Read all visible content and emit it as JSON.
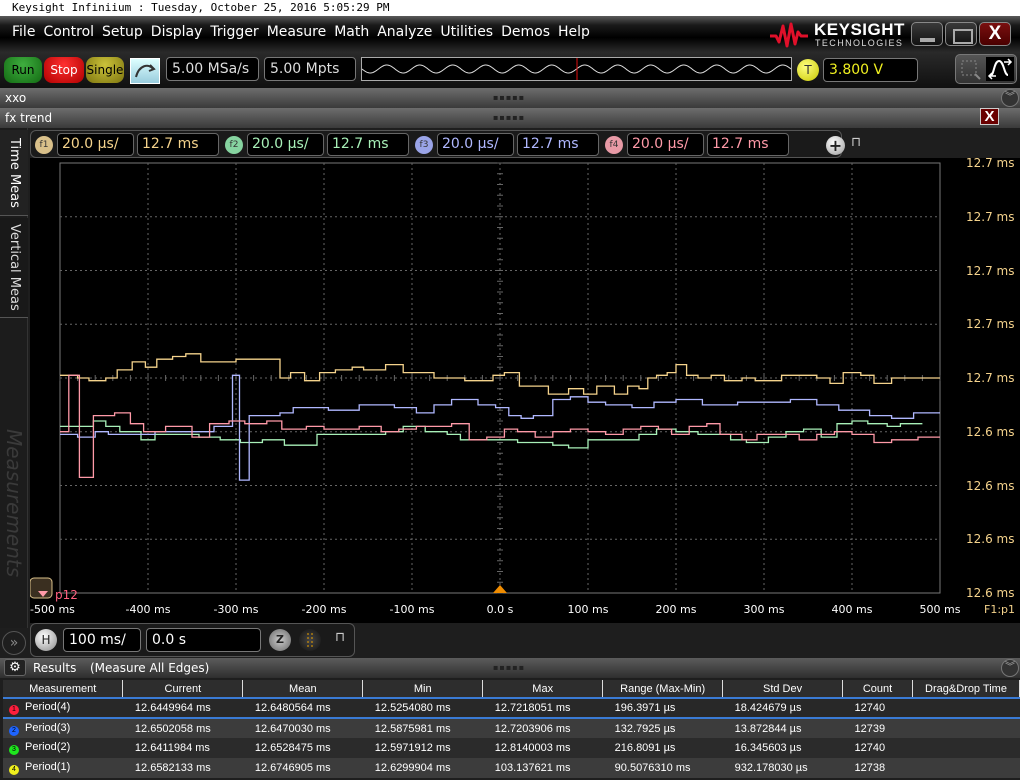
{
  "window": {
    "title": "Keysight Infiniium : Tuesday, October 25, 2016 5:05:29 PM",
    "brand": "KEYSIGHT",
    "brand_sub": "TECHNOLOGIES",
    "close_label": "X"
  },
  "menu": [
    "File",
    "Control",
    "Setup",
    "Display",
    "Trigger",
    "Measure",
    "Math",
    "Analyze",
    "Utilities",
    "Demos",
    "Help"
  ],
  "toolbar": {
    "run": "Run",
    "stop": "Stop",
    "single": "Single",
    "sample_rate": "5.00 MSa/s",
    "memory_depth": "5.00 Mpts",
    "trigger_badge": "T",
    "trigger_level": "3.800 V"
  },
  "panels": {
    "xxo": "xxo",
    "fx_trend": "fx trend",
    "grip": "▪▪▪▪▪"
  },
  "side_tabs": [
    "Time Meas",
    "Vertical Meas"
  ],
  "side_ghost": "Measurements",
  "functions": [
    {
      "badge": "f1",
      "scale": "20.0 µs/",
      "offset": "12.7 ms",
      "color": "#f5d38c",
      "badge_color": "#d9c08a"
    },
    {
      "badge": "f2",
      "scale": "20.0 µs/",
      "offset": "12.7 ms",
      "color": "#a8f0b8",
      "badge_color": "#86d4a0"
    },
    {
      "badge": "f3",
      "scale": "20.0 µs/",
      "offset": "12.7 ms",
      "color": "#b0b8ff",
      "badge_color": "#9aa4e8"
    },
    {
      "badge": "f4",
      "scale": "20.0 µs/",
      "offset": "12.7 ms",
      "color": "#ff9aa8",
      "badge_color": "#e89aa6"
    }
  ],
  "horizontal": {
    "badge": "H",
    "scale": "100 ms/",
    "position": "0.0 s"
  },
  "plot_marker": "p12",
  "plot_source": "F1:p1",
  "chart_data": {
    "type": "line",
    "title": "fx trend",
    "xlabel": "",
    "ylabel": "",
    "x_ticks": [
      "-500 ms",
      "-400 ms",
      "-300 ms",
      "-200 ms",
      "-100 ms",
      "0.0 s",
      "100 ms",
      "200 ms",
      "300 ms",
      "400 ms",
      "500 ms"
    ],
    "y_ticks": [
      "12.7 ms",
      "12.7 ms",
      "12.7 ms",
      "12.7 ms",
      "12.7 ms",
      "12.6 ms",
      "12.6 ms",
      "12.6 ms",
      "12.6 ms"
    ],
    "xlim_ms": [
      -500,
      500
    ],
    "ylim_ms": [
      12.62,
      12.78
    ],
    "grid": true,
    "step": true,
    "series": [
      {
        "name": "f1",
        "color": "#f5d38c",
        "points": [
          [
            -500,
            12.701
          ],
          [
            -480,
            12.7
          ],
          [
            -467,
            12.699
          ],
          [
            -448,
            12.7
          ],
          [
            -435,
            12.703
          ],
          [
            -418,
            12.706
          ],
          [
            -403,
            12.704
          ],
          [
            -390,
            12.707
          ],
          [
            -372,
            12.708
          ],
          [
            -357,
            12.709
          ],
          [
            -340,
            12.706
          ],
          [
            -300,
            12.707
          ],
          [
            -275,
            12.707
          ],
          [
            -250,
            12.7
          ],
          [
            -238,
            12.702
          ],
          [
            -222,
            12.699
          ],
          [
            -205,
            12.702
          ],
          [
            -187,
            12.703
          ],
          [
            -168,
            12.704
          ],
          [
            -155,
            12.703
          ],
          [
            -130,
            12.705
          ],
          [
            -110,
            12.702
          ],
          [
            -93,
            12.702
          ],
          [
            -75,
            12.7
          ],
          [
            -58,
            12.7
          ],
          [
            -40,
            12.699
          ],
          [
            -22,
            12.699
          ],
          [
            -8,
            12.701
          ],
          [
            5,
            12.702
          ],
          [
            22,
            12.697
          ],
          [
            40,
            12.697
          ],
          [
            55,
            12.694
          ],
          [
            78,
            12.696
          ],
          [
            95,
            12.694
          ],
          [
            110,
            12.697
          ],
          [
            130,
            12.694
          ],
          [
            145,
            12.697
          ],
          [
            158,
            12.696
          ],
          [
            168,
            12.7
          ],
          [
            178,
            12.701
          ],
          [
            190,
            12.702
          ],
          [
            200,
            12.705
          ],
          [
            212,
            12.701
          ],
          [
            225,
            12.7
          ],
          [
            240,
            12.701
          ],
          [
            255,
            12.699
          ],
          [
            275,
            12.7
          ],
          [
            290,
            12.699
          ],
          [
            305,
            12.699
          ],
          [
            320,
            12.701
          ],
          [
            340,
            12.701
          ],
          [
            360,
            12.7
          ],
          [
            375,
            12.698
          ],
          [
            390,
            12.702
          ],
          [
            410,
            12.701
          ],
          [
            425,
            12.698
          ],
          [
            445,
            12.7
          ],
          [
            470,
            12.7
          ],
          [
            490,
            12.7
          ]
        ]
      },
      {
        "name": "f2",
        "color": "#a8f0b8",
        "points": [
          [
            -500,
            12.682
          ],
          [
            -462,
            12.684
          ],
          [
            -448,
            12.682
          ],
          [
            -432,
            12.68
          ],
          [
            -408,
            12.677
          ],
          [
            -392,
            12.679
          ],
          [
            -372,
            12.679
          ],
          [
            -342,
            12.678
          ],
          [
            -318,
            12.677
          ],
          [
            -295,
            12.676
          ],
          [
            -270,
            12.677
          ],
          [
            -245,
            12.675
          ],
          [
            -208,
            12.679
          ],
          [
            -160,
            12.679
          ],
          [
            -130,
            12.68
          ],
          [
            -110,
            12.682
          ],
          [
            -85,
            12.68
          ],
          [
            -60,
            12.679
          ],
          [
            -45,
            12.677
          ],
          [
            -20,
            12.677
          ],
          [
            5,
            12.677
          ],
          [
            20,
            12.676
          ],
          [
            40,
            12.676
          ],
          [
            60,
            12.675
          ],
          [
            78,
            12.674
          ],
          [
            100,
            12.677
          ],
          [
            130,
            12.677
          ],
          [
            158,
            12.679
          ],
          [
            178,
            12.681
          ],
          [
            200,
            12.68
          ],
          [
            225,
            12.679
          ],
          [
            262,
            12.677
          ],
          [
            280,
            12.676
          ],
          [
            305,
            12.678
          ],
          [
            325,
            12.68
          ],
          [
            345,
            12.681
          ],
          [
            365,
            12.678
          ],
          [
            383,
            12.683
          ],
          [
            400,
            12.684
          ],
          [
            418,
            12.683
          ],
          [
            440,
            12.682
          ],
          [
            455,
            12.683
          ],
          [
            470,
            12.683
          ]
        ]
      },
      {
        "name": "f3",
        "color": "#b0b8ff",
        "points": [
          [
            -500,
            12.679
          ],
          [
            -480,
            12.678
          ],
          [
            -460,
            12.68
          ],
          [
            -445,
            12.679
          ],
          [
            -425,
            12.679
          ],
          [
            -392,
            12.68
          ],
          [
            -358,
            12.68
          ],
          [
            -325,
            12.682
          ],
          [
            -304,
            12.701
          ],
          [
            -296,
            12.662
          ],
          [
            -285,
            12.686
          ],
          [
            -250,
            12.687
          ],
          [
            -235,
            12.689
          ],
          [
            -195,
            12.688
          ],
          [
            -160,
            12.69
          ],
          [
            -120,
            12.689
          ],
          [
            -95,
            12.687
          ],
          [
            -75,
            12.69
          ],
          [
            -55,
            12.692
          ],
          [
            -25,
            12.69
          ],
          [
            -5,
            12.689
          ],
          [
            10,
            12.686
          ],
          [
            24,
            12.685
          ],
          [
            38,
            12.686
          ],
          [
            60,
            12.692
          ],
          [
            80,
            12.693
          ],
          [
            100,
            12.691
          ],
          [
            120,
            12.69
          ],
          [
            150,
            12.689
          ],
          [
            175,
            12.691
          ],
          [
            200,
            12.692
          ],
          [
            230,
            12.69
          ],
          [
            270,
            12.691
          ],
          [
            300,
            12.691
          ],
          [
            330,
            12.692
          ],
          [
            360,
            12.69
          ],
          [
            385,
            12.688
          ],
          [
            420,
            12.686
          ],
          [
            445,
            12.685
          ],
          [
            470,
            12.687
          ],
          [
            490,
            12.687
          ]
        ]
      },
      {
        "name": "f4",
        "color": "#ff9aa8",
        "points": [
          [
            -500,
            12.68
          ],
          [
            -490,
            12.701
          ],
          [
            -478,
            12.663
          ],
          [
            -462,
            12.686
          ],
          [
            -438,
            12.687
          ],
          [
            -420,
            12.683
          ],
          [
            -405,
            12.68
          ],
          [
            -380,
            12.682
          ],
          [
            -350,
            12.678
          ],
          [
            -330,
            12.683
          ],
          [
            -308,
            12.684
          ],
          [
            -290,
            12.683
          ],
          [
            -265,
            12.684
          ],
          [
            -248,
            12.681
          ],
          [
            -220,
            12.682
          ],
          [
            -200,
            12.681
          ],
          [
            -185,
            12.681
          ],
          [
            -160,
            12.682
          ],
          [
            -135,
            12.68
          ],
          [
            -115,
            12.681
          ],
          [
            -95,
            12.682
          ],
          [
            -55,
            12.683
          ],
          [
            -35,
            12.677
          ],
          [
            -15,
            12.678
          ],
          [
            5,
            12.681
          ],
          [
            20,
            12.68
          ],
          [
            40,
            12.678
          ],
          [
            60,
            12.68
          ],
          [
            80,
            12.681
          ],
          [
            100,
            12.68
          ],
          [
            120,
            12.679
          ],
          [
            140,
            12.681
          ],
          [
            160,
            12.682
          ],
          [
            180,
            12.681
          ],
          [
            195,
            12.679
          ],
          [
            215,
            12.682
          ],
          [
            235,
            12.683
          ],
          [
            250,
            12.679
          ],
          [
            275,
            12.677
          ],
          [
            292,
            12.679
          ],
          [
            312,
            12.679
          ],
          [
            340,
            12.677
          ],
          [
            360,
            12.679
          ],
          [
            380,
            12.68
          ],
          [
            400,
            12.679
          ],
          [
            425,
            12.676
          ],
          [
            445,
            12.677
          ],
          [
            475,
            12.678
          ],
          [
            490,
            12.678
          ]
        ]
      }
    ]
  },
  "results": {
    "title": "Results",
    "subtitle": "(Measure All Edges)",
    "columns": [
      "Measurement",
      "Current",
      "Mean",
      "Min",
      "Max",
      "Range (Max-Min)",
      "Std Dev",
      "Count",
      "Drag&Drop Time"
    ],
    "rows": [
      {
        "index": "1",
        "dot_color": "#ff1e3c",
        "name": "Period(4)",
        "current": "12.6449964 ms",
        "mean": "12.6480564 ms",
        "min": "12.5254080 ms",
        "max": "12.7218051 ms",
        "range": "196.3971 µs",
        "std": "18.424679 µs",
        "count": "12740",
        "drag": ""
      },
      {
        "index": "2",
        "dot_color": "#1e64ff",
        "name": "Period(3)",
        "current": "12.6502058 ms",
        "mean": "12.6470030 ms",
        "min": "12.5875981 ms",
        "max": "12.7203906 ms",
        "range": "132.7925 µs",
        "std": "13.872844 µs",
        "count": "12739",
        "drag": ""
      },
      {
        "index": "3",
        "dot_color": "#1ee61e",
        "name": "Period(2)",
        "current": "12.6411984 ms",
        "mean": "12.6528475 ms",
        "min": "12.5971912 ms",
        "max": "12.8140003 ms",
        "range": "216.8091 µs",
        "std": "16.345603 µs",
        "count": "12740",
        "drag": ""
      },
      {
        "index": "4",
        "dot_color": "#f0f01e",
        "name": "Period(1)",
        "current": "12.6582133 ms",
        "mean": "12.6746905 ms",
        "min": "12.6299904 ms",
        "max": "103.137621 ms",
        "range": "90.5076310 ms",
        "std": "932.178030 µs",
        "count": "12738",
        "drag": ""
      }
    ]
  }
}
